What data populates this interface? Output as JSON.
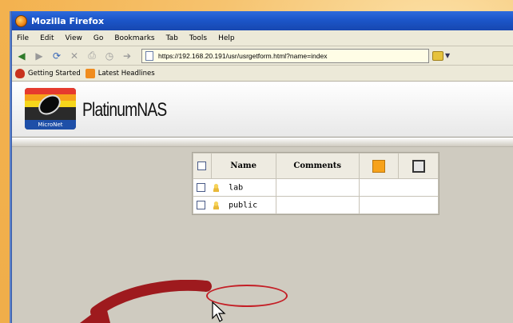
{
  "window": {
    "title": "Mozilla Firefox"
  },
  "menu": [
    "File",
    "Edit",
    "View",
    "Go",
    "Bookmarks",
    "Tab",
    "Tools",
    "Help"
  ],
  "nav": {
    "url": "https://192.168.20.191/usr/usrgetform.html?name=index"
  },
  "bookmarks": [
    {
      "label": "Getting Started",
      "icon": "getting-started-icon"
    },
    {
      "label": "Latest Headlines",
      "icon": "rss-icon"
    }
  ],
  "banner": {
    "brand": "MicroNet",
    "product": "PlatinumNAS"
  },
  "table": {
    "headers": {
      "name": "Name",
      "comments": "Comments"
    },
    "rows": [
      {
        "name": "lab",
        "comments": ""
      },
      {
        "name": "public",
        "comments": ""
      }
    ]
  },
  "colors": {
    "titlebar": "#1c56c9",
    "highlight": "#c41f26",
    "background": "#f0ae4a"
  }
}
